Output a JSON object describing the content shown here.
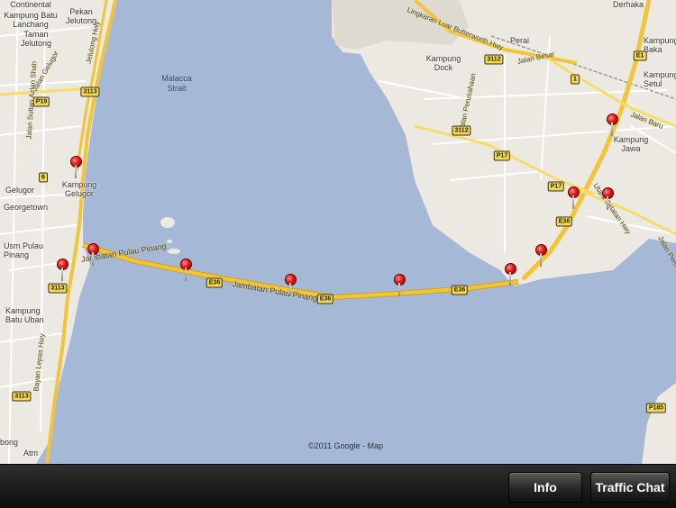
{
  "map": {
    "copyright": "©2011 Google - Map",
    "water_label": [
      "Malacca",
      "Strait"
    ],
    "places": [
      {
        "id": "continental",
        "text": "Continental"
      },
      {
        "id": "kampung-batu-lanchang",
        "text": "Kampung Batu\nLanchang"
      },
      {
        "id": "pekan-jelutong",
        "text": "Pekan\nJelutong"
      },
      {
        "id": "taman-jelutong",
        "text": "Taman\nJelutong"
      },
      {
        "id": "kampung-gelugor",
        "text": "Kampung\nGelugor"
      },
      {
        "id": "gelugor",
        "text": "Gelugor"
      },
      {
        "id": "georgetown",
        "text": "Georgetown"
      },
      {
        "id": "usm-pulau-pinang",
        "text": "Usm Pulau\nPinang"
      },
      {
        "id": "kampung-batu-uban",
        "text": "Kampung\nBatu Uban"
      },
      {
        "id": "derhaka",
        "text": "Derhaka"
      },
      {
        "id": "perai",
        "text": "Perai"
      },
      {
        "id": "kampung-dock",
        "text": "Kampung\nDock"
      },
      {
        "id": "kampung-baka",
        "text": "Kampung\nBaka"
      },
      {
        "id": "kampung-setul",
        "text": "Kampung\nSetul"
      },
      {
        "id": "kampung-jawa",
        "text": "Kampung\nJawa"
      },
      {
        "id": "atm",
        "text": "Atm"
      },
      {
        "id": "bong",
        "text": "bong"
      }
    ],
    "roads": [
      {
        "id": "lingkaran",
        "text": "Lingkaran Luar Butterworth Hwy"
      },
      {
        "id": "jalan-besar",
        "text": "Jalan Besar"
      },
      {
        "id": "jalan-perusahaan",
        "text": "Jalan Perusahaan"
      },
      {
        "id": "jalan-baru",
        "text": "Jalan Baru"
      },
      {
        "id": "jambatan-1",
        "text": "Jambatan Pulau Pinang"
      },
      {
        "id": "jambatan-2",
        "text": "Jambatan Pulau Pinang"
      },
      {
        "id": "utara-selatan",
        "text": "Utara Selatan Hwy"
      },
      {
        "id": "bayan-lepas",
        "text": "Bayan Lepas Hwy"
      },
      {
        "id": "jalan-sultan-azlan",
        "text": "Jalan Sultan Azlan Shah"
      },
      {
        "id": "jalan-gelugor",
        "text": "Jalan Gelugor"
      },
      {
        "id": "jelutong-hwy",
        "text": "Jelutong Hwy"
      },
      {
        "id": "jalan-permatang",
        "text": "Jalan Permatang"
      }
    ],
    "shields": [
      {
        "id": "s3113a",
        "text": "3113"
      },
      {
        "id": "sP19",
        "text": "P19"
      },
      {
        "id": "s6",
        "text": "6"
      },
      {
        "id": "s3113b",
        "text": "3113"
      },
      {
        "id": "s3113c",
        "text": "3113"
      },
      {
        "id": "sE36a",
        "text": "E36"
      },
      {
        "id": "sE36b",
        "text": "E36"
      },
      {
        "id": "sE36c",
        "text": "E36"
      },
      {
        "id": "sE36d",
        "text": "E36"
      },
      {
        "id": "s3112a",
        "text": "3112"
      },
      {
        "id": "s3112b",
        "text": "3112"
      },
      {
        "id": "s1",
        "text": "1"
      },
      {
        "id": "sE1",
        "text": "E1"
      },
      {
        "id": "sP17a",
        "text": "P17"
      },
      {
        "id": "sP17b",
        "text": "P17"
      },
      {
        "id": "sP185",
        "text": "P185"
      }
    ],
    "pins": [
      {
        "id": "pin-kampung-gelugor"
      },
      {
        "id": "pin-penang-west-1"
      },
      {
        "id": "pin-penang-west-2"
      },
      {
        "id": "pin-bridge-1"
      },
      {
        "id": "pin-bridge-2"
      },
      {
        "id": "pin-bridge-3"
      },
      {
        "id": "pin-bridge-4"
      },
      {
        "id": "pin-bridge-east"
      },
      {
        "id": "pin-toll-plaza"
      },
      {
        "id": "pin-interchange-1"
      },
      {
        "id": "pin-interchange-2"
      },
      {
        "id": "pin-kampung-jawa"
      }
    ]
  },
  "toolbar": {
    "info_label": "Info",
    "traffic_chat_label": "Traffic Chat"
  },
  "colors": {
    "water": "#a5b8d6",
    "land": "#ece9e2",
    "highway": "#f2c43a",
    "pin": "#e01818",
    "toolbar": "#1a1a1a"
  }
}
